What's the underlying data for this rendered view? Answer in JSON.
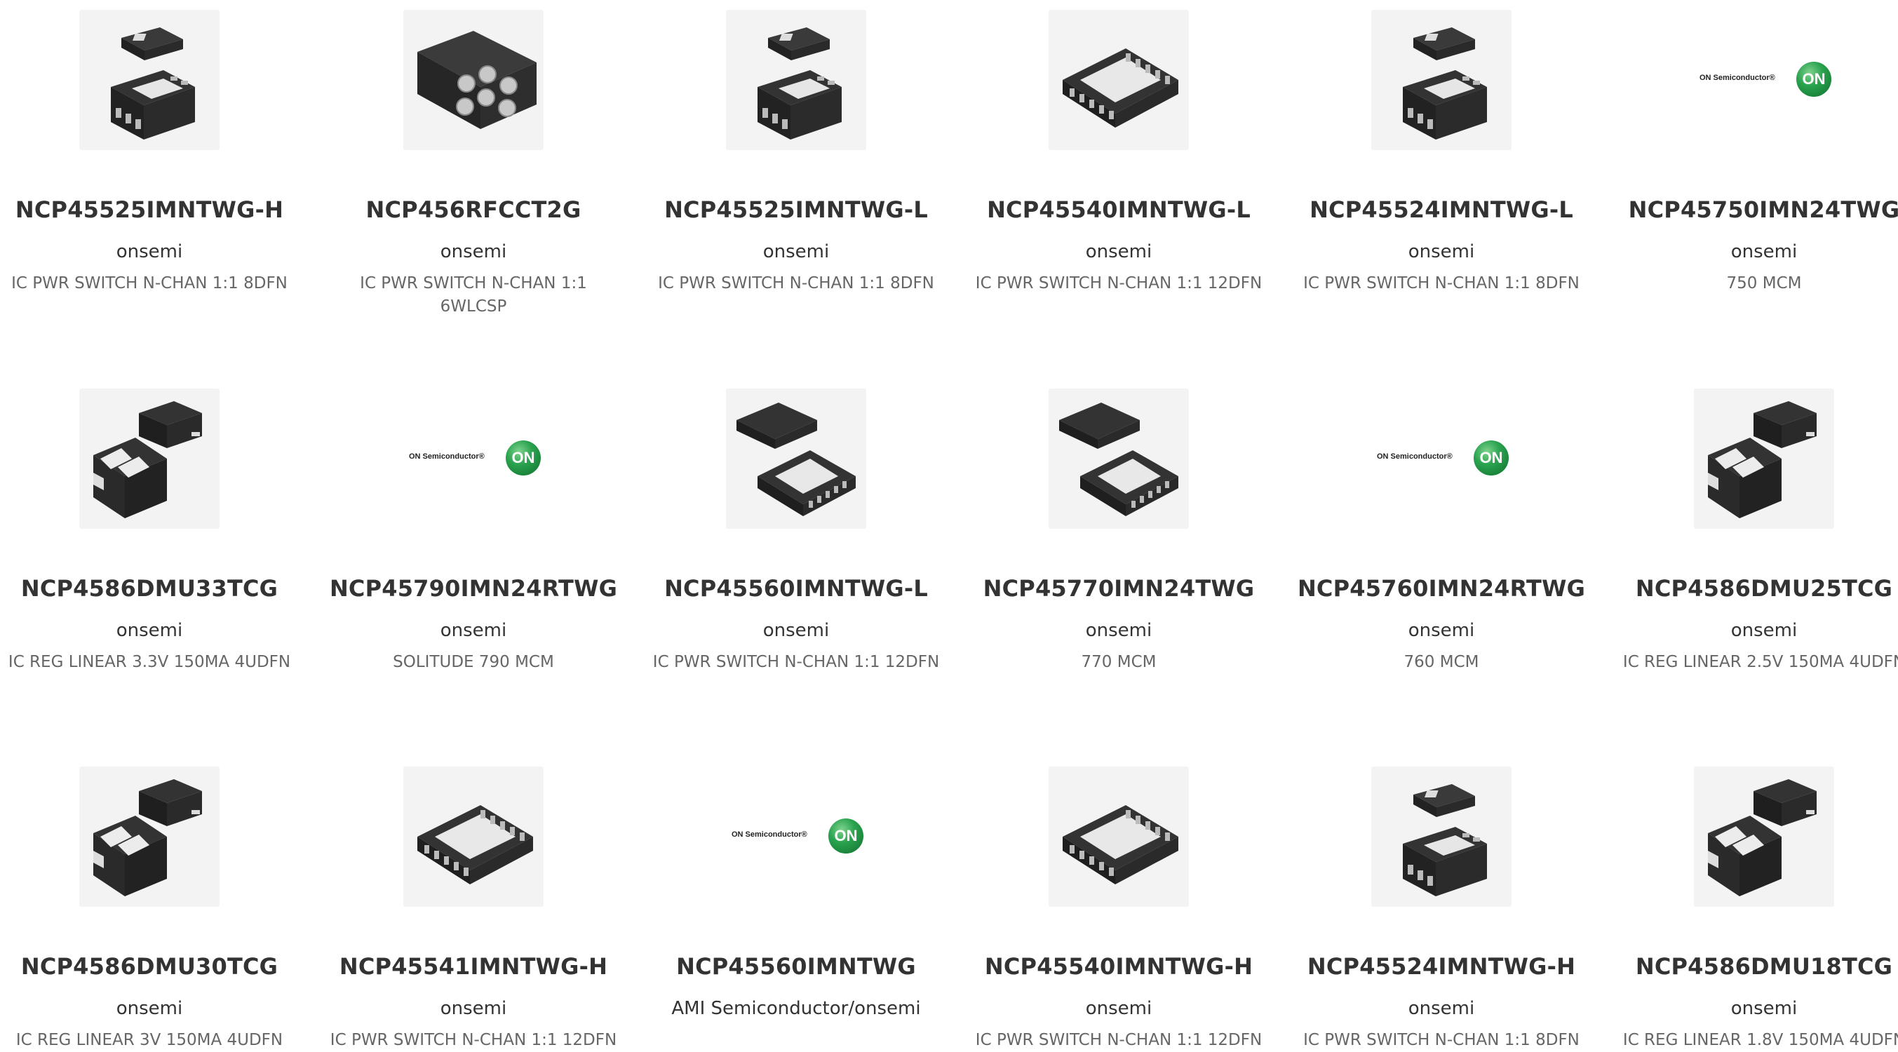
{
  "products": [
    {
      "part": "NCP45525IMNTWG-H",
      "manufacturer": "onsemi",
      "description": "IC PWR SWITCH N-CHAN 1:1 8DFN",
      "image": "dfn8-chip-pair-icon"
    },
    {
      "part": "NCP456RFCCT2G",
      "manufacturer": "onsemi",
      "description": "IC PWR SWITCH N-CHAN 1:1 6WLCSP",
      "image": "wlcsp-chip-icon"
    },
    {
      "part": "NCP45525IMNTWG-L",
      "manufacturer": "onsemi",
      "description": "IC PWR SWITCH N-CHAN 1:1 8DFN",
      "image": "dfn8-chip-pair-icon"
    },
    {
      "part": "NCP45540IMNTWG-L",
      "manufacturer": "onsemi",
      "description": "IC PWR SWITCH N-CHAN 1:1 12DFN",
      "image": "dfn12-chip-icon"
    },
    {
      "part": "NCP45524IMNTWG-L",
      "manufacturer": "onsemi",
      "description": "IC PWR SWITCH N-CHAN 1:1 8DFN",
      "image": "dfn8-chip-pair-icon"
    },
    {
      "part": "NCP45750IMN24TWG",
      "manufacturer": "onsemi",
      "description": "750 MCM",
      "image": "on-semiconductor-logo",
      "logo_text": "ON Semiconductor®",
      "logo_badge": "ON"
    },
    {
      "part": "NCP4586DMU33TCG",
      "manufacturer": "onsemi",
      "description": "IC REG LINEAR 3.3V 150MA 4UDFN",
      "image": "udfn4-chip-pair-icon"
    },
    {
      "part": "NCP45790IMN24RTWG",
      "manufacturer": "onsemi",
      "description": "SOLITUDE 790 MCM",
      "image": "on-semiconductor-logo",
      "logo_text": "ON Semiconductor®",
      "logo_badge": "ON"
    },
    {
      "part": "NCP45560IMNTWG-L",
      "manufacturer": "onsemi",
      "description": "IC PWR SWITCH N-CHAN 1:1 12DFN",
      "image": "dfn12-chip-pair-icon"
    },
    {
      "part": "NCP45770IMN24TWG",
      "manufacturer": "onsemi",
      "description": "770 MCM",
      "image": "dfn12-chip-pair-icon"
    },
    {
      "part": "NCP45760IMN24RTWG",
      "manufacturer": "onsemi",
      "description": "760 MCM",
      "image": "on-semiconductor-logo",
      "logo_text": "ON Semiconductor®",
      "logo_badge": "ON"
    },
    {
      "part": "NCP4586DMU25TCG",
      "manufacturer": "onsemi",
      "description": "IC REG LINEAR 2.5V 150MA 4UDFN",
      "image": "udfn4-chip-pair-icon"
    },
    {
      "part": "NCP4586DMU30TCG",
      "manufacturer": "onsemi",
      "description": "IC REG LINEAR 3V 150MA 4UDFN",
      "image": "udfn4-chip-pair-icon"
    },
    {
      "part": "NCP45541IMNTWG-H",
      "manufacturer": "onsemi",
      "description": "IC PWR SWITCH N-CHAN 1:1 12DFN",
      "image": "dfn12-chip-icon"
    },
    {
      "part": "NCP45560IMNTWG",
      "manufacturer": "AMI Semiconductor/onsemi",
      "description": "",
      "image": "on-semiconductor-logo",
      "logo_text": "ON Semiconductor®",
      "logo_badge": "ON"
    },
    {
      "part": "NCP45540IMNTWG-H",
      "manufacturer": "onsemi",
      "description": "IC PWR SWITCH N-CHAN 1:1 12DFN",
      "image": "dfn12-chip-icon"
    },
    {
      "part": "NCP45524IMNTWG-H",
      "manufacturer": "onsemi",
      "description": "IC PWR SWITCH N-CHAN 1:1 8DFN",
      "image": "dfn8-chip-pair-icon"
    },
    {
      "part": "NCP4586DMU18TCG",
      "manufacturer": "onsemi",
      "description": "IC REG LINEAR 1.8V 150MA 4UDFN",
      "image": "udfn4-chip-pair-icon"
    }
  ],
  "colors": {
    "part_text": "#333333",
    "description_text": "#666666",
    "chip_body": "#2f2f2f",
    "logo_green": "#1a9a4a"
  }
}
